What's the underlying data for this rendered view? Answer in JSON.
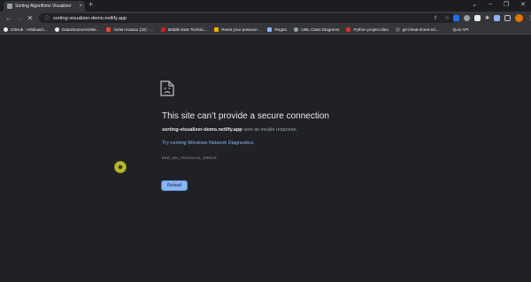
{
  "browser": {
    "tab": {
      "title": "Sorting Algorithms Visualizer",
      "close_glyph": "×"
    },
    "new_tab_glyph": "+",
    "window_controls": [
      "⌄",
      "–",
      "❐",
      "✕"
    ],
    "nav": {
      "back": "←",
      "forward": "→",
      "reload": "✕"
    },
    "omnibox": {
      "url": "sorting-visualizer-demo.netlify.app"
    },
    "bookmarks": [
      {
        "label": "GitHub - erbilnas/c...",
        "color": "#e8eaed"
      },
      {
        "label": "DataStructures/We...",
        "color": "#e8eaed"
      },
      {
        "label": "Gelen Kutusu (32) - ...",
        "color": "#ea4335"
      },
      {
        "label": "Middle East Technic...",
        "color": "#c5221f"
      },
      {
        "label": "Reset your passwor...",
        "color": "#f9ab00"
      },
      {
        "label": "RegEx",
        "color": "#8ab4f8"
      },
      {
        "label": "UML Class Diagrams",
        "color": "#9aa0a6"
      },
      {
        "label": "Python project idea",
        "color": "#d93025"
      },
      {
        "label": "git-cheat-sheet-ed...",
        "color": "#5f6368"
      },
      {
        "label": "Quiz API",
        "color": "#35363a"
      }
    ]
  },
  "error_page": {
    "heading": "This site can’t provide a secure connection",
    "domain": "sorting-visualizer-demo.netlify.app",
    "message_suffix": " sent an invalid response.",
    "suggestion": "Try running Windows Network Diagnostics.",
    "error_code": "ERR_SSL_PROTOCOL_ERROR",
    "reload_label": "Reload"
  }
}
